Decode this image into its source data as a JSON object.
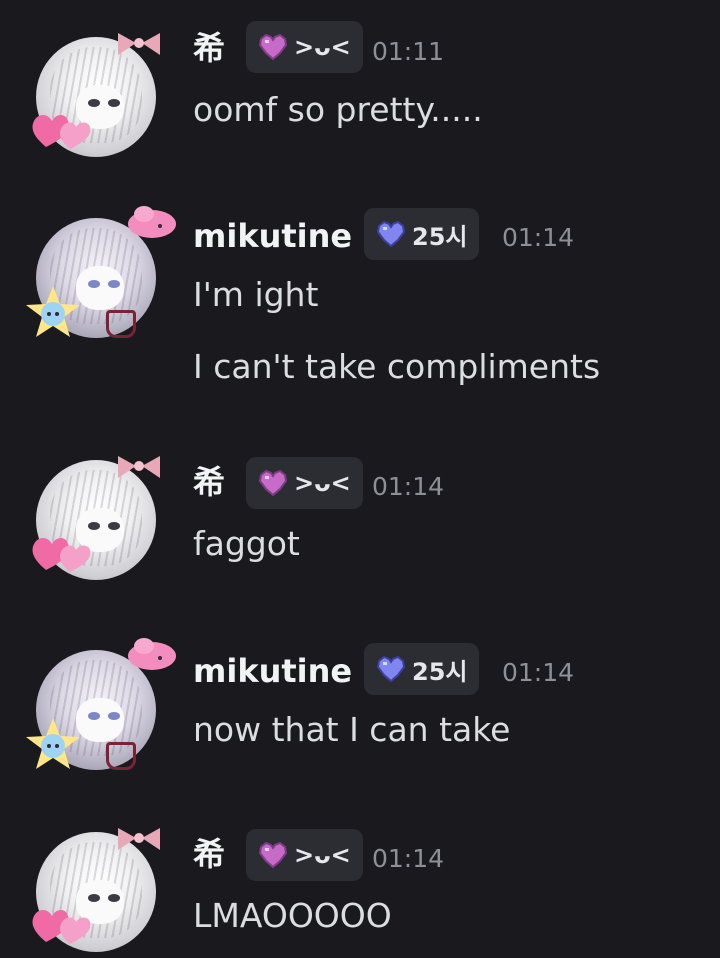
{
  "messages": [
    {
      "author": "希",
      "tag": ">ᴗ<",
      "time": "01:11",
      "lines": [
        "oomf so pretty....."
      ]
    },
    {
      "author": "mikutine",
      "tag": "25시",
      "time": "01:14",
      "lines": [
        "I'm ight",
        "I can't take compliments"
      ]
    },
    {
      "author": "希",
      "tag": ">ᴗ<",
      "time": "01:14",
      "lines": [
        "faggot"
      ]
    },
    {
      "author": "mikutine",
      "tag": "25시",
      "time": "01:14",
      "lines": [
        "now that I can take"
      ]
    },
    {
      "author": "希",
      "tag": ">ᴗ<",
      "time": "01:14",
      "lines": [
        "LMAOOOOO"
      ]
    }
  ],
  "colors": {
    "background": "#1a1a1e",
    "badge_bg": "#2b2d33",
    "heart_pink": "#d36fc9",
    "heart_blue": "#7f86f0",
    "timestamp": "#8e9097"
  },
  "icons": {
    "user_a_tag": "pink-pixel-heart-icon",
    "user_b_tag": "blue-pixel-heart-icon"
  }
}
